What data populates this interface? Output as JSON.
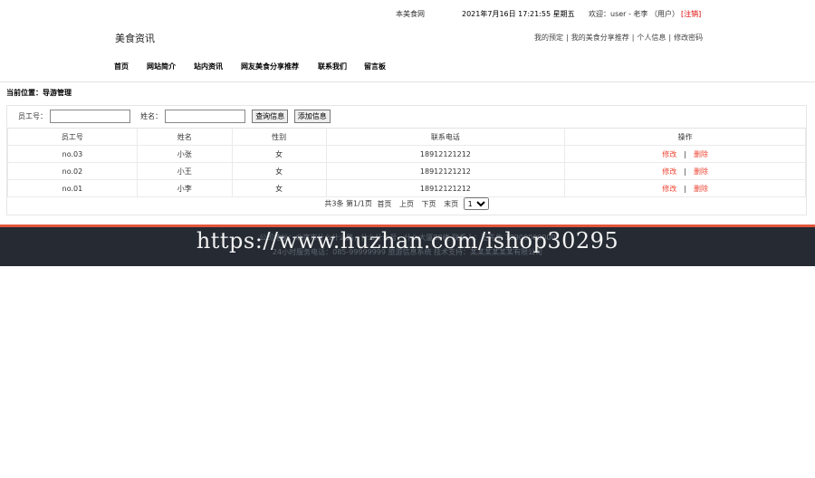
{
  "topbar": {
    "site_name": "本美食网",
    "datetime": "2021年7月16日 17:21:55 星期五",
    "welcome": "欢迎：user - 老李 （用户）",
    "logout": "[注销]"
  },
  "brand": {
    "title": "美食资讯"
  },
  "user_links": [
    "我的预定",
    "我的美食分享推荐",
    "个人信息",
    "修改密码"
  ],
  "user_links_sep": "|",
  "nav": [
    "首页",
    "网站简介",
    "站内资讯",
    "网友美食分享推荐",
    "联系我们",
    "留言板"
  ],
  "breadcrumb": "当前位置：导游管理",
  "search": {
    "emp_label": "员工号：",
    "emp_value": "",
    "name_label": "姓名：",
    "name_value": "",
    "query_button": "查询信息",
    "add_button": "添加信息"
  },
  "table": {
    "headers": [
      "员工号",
      "姓名",
      "性别",
      "联系电话",
      "操作"
    ],
    "rows": [
      [
        "no.03",
        "小张",
        "女",
        "18912121212"
      ],
      [
        "no.02",
        "小王",
        "女",
        "18912121212"
      ],
      [
        "no.01",
        "小李",
        "女",
        "18912121212"
      ]
    ],
    "op_edit": "修改",
    "op_sep": "|",
    "op_delete": "删除"
  },
  "pager": {
    "summary": "共3条 第1/1页",
    "first": "首页",
    "prev": "上页",
    "next": "下页",
    "last": "末页",
    "page_select_value": "1"
  },
  "footer": {
    "line1": "公司地址：北京市什么什么路，什么什么号，什么大厦88楼  联系人：王先生 18900000000",
    "line2": "24小时服务电话：085-99999999  旅游信息系统  技术支持：某某某某某某有限公司"
  },
  "watermark": "https://www.huzhan.com/ishop30295",
  "colors": {
    "accent": "#e2553a",
    "footer_bg": "#252a33",
    "link_red": "#e43"
  }
}
